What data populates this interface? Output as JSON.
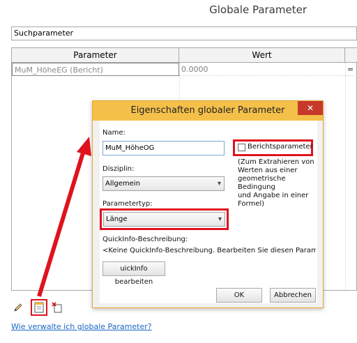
{
  "window": {
    "title": "Globale Parameter"
  },
  "search": {
    "placeholder": "Suchparameter"
  },
  "table": {
    "columns": [
      "Parameter",
      "Wert"
    ],
    "rows": [
      {
        "name": "MuM_HöheEG (Bericht)",
        "value": "0.0000",
        "extra": "="
      }
    ]
  },
  "toolbar": {
    "edit_icon": "pencil-icon",
    "new_icon": "new-parameter-icon",
    "delete_icon": "delete-parameter-icon"
  },
  "help_link": "Wie verwalte ich globale Parameter?",
  "dialog": {
    "title": "Eigenschaften globaler Parameter",
    "close_symbol": "✕",
    "name_label": "Name:",
    "name_value": "MuM_HöheOG",
    "report_checkbox_label": "Berichtsparameter",
    "report_checked": false,
    "report_note": [
      "(Zum Extrahieren von",
      "Werten aus einer",
      "geometrische Bedingung",
      "und Angabe in einer",
      "Formel)"
    ],
    "discipline_label": "Disziplin:",
    "discipline_value": "Allgemein",
    "type_label": "Parametertyp:",
    "type_value": "Länge",
    "tooltip_label": "QuickInfo-Beschreibung:",
    "tooltip_text": "<Keine QuickInfo-Beschreibung. Bearbeiten Sie diesen Parameter...",
    "edit_tooltip_button": "uickInfo bearbeiten",
    "ok_button": "OK",
    "cancel_button": "Abbrechen"
  },
  "colors": {
    "highlight": "#e0121f",
    "dialog_title_bar": "#f5c04a",
    "close_button": "#c7392b",
    "link": "#1a66c4"
  }
}
